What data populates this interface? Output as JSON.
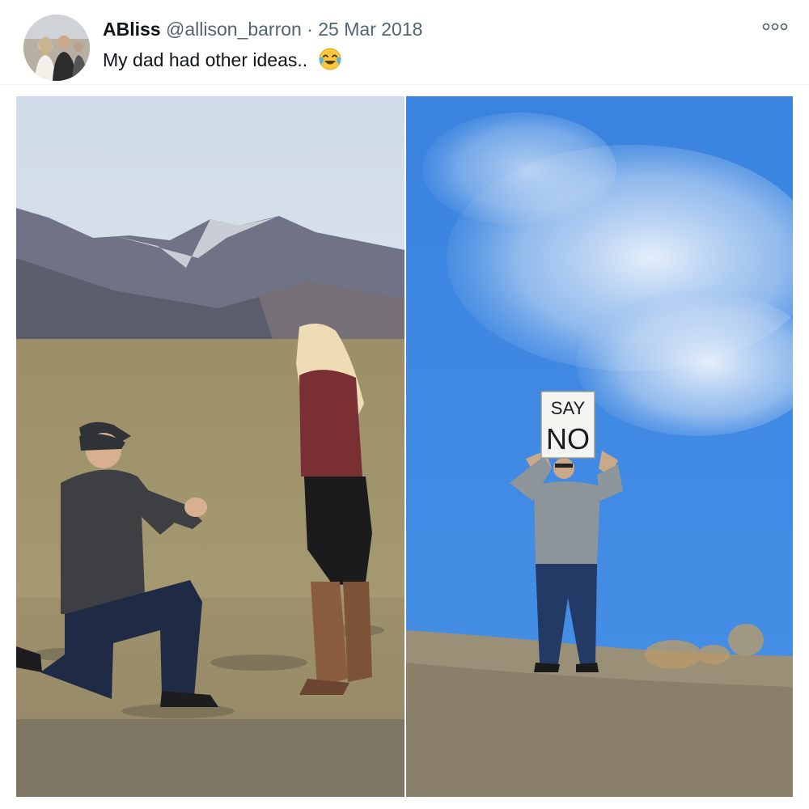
{
  "tweet": {
    "display_name": "ABliss",
    "handle": "@allison_barron",
    "separator": "·",
    "date": "25 Mar 2018",
    "text": "My dad had other ideas.."
  },
  "icons": {
    "avatar": "avatar-photo",
    "more": "more-options-icon",
    "emoji": "face-with-tears-of-joy"
  },
  "media": {
    "photos": [
      {
        "description_icon": "proposal-photo"
      },
      {
        "description_icon": "dad-sign-photo",
        "sign_line_1": "SAY",
        "sign_line_2": "NO"
      }
    ]
  },
  "colors": {
    "name": "#0f1419",
    "secondary": "#536471",
    "sky_right": "#3f87e2"
  }
}
